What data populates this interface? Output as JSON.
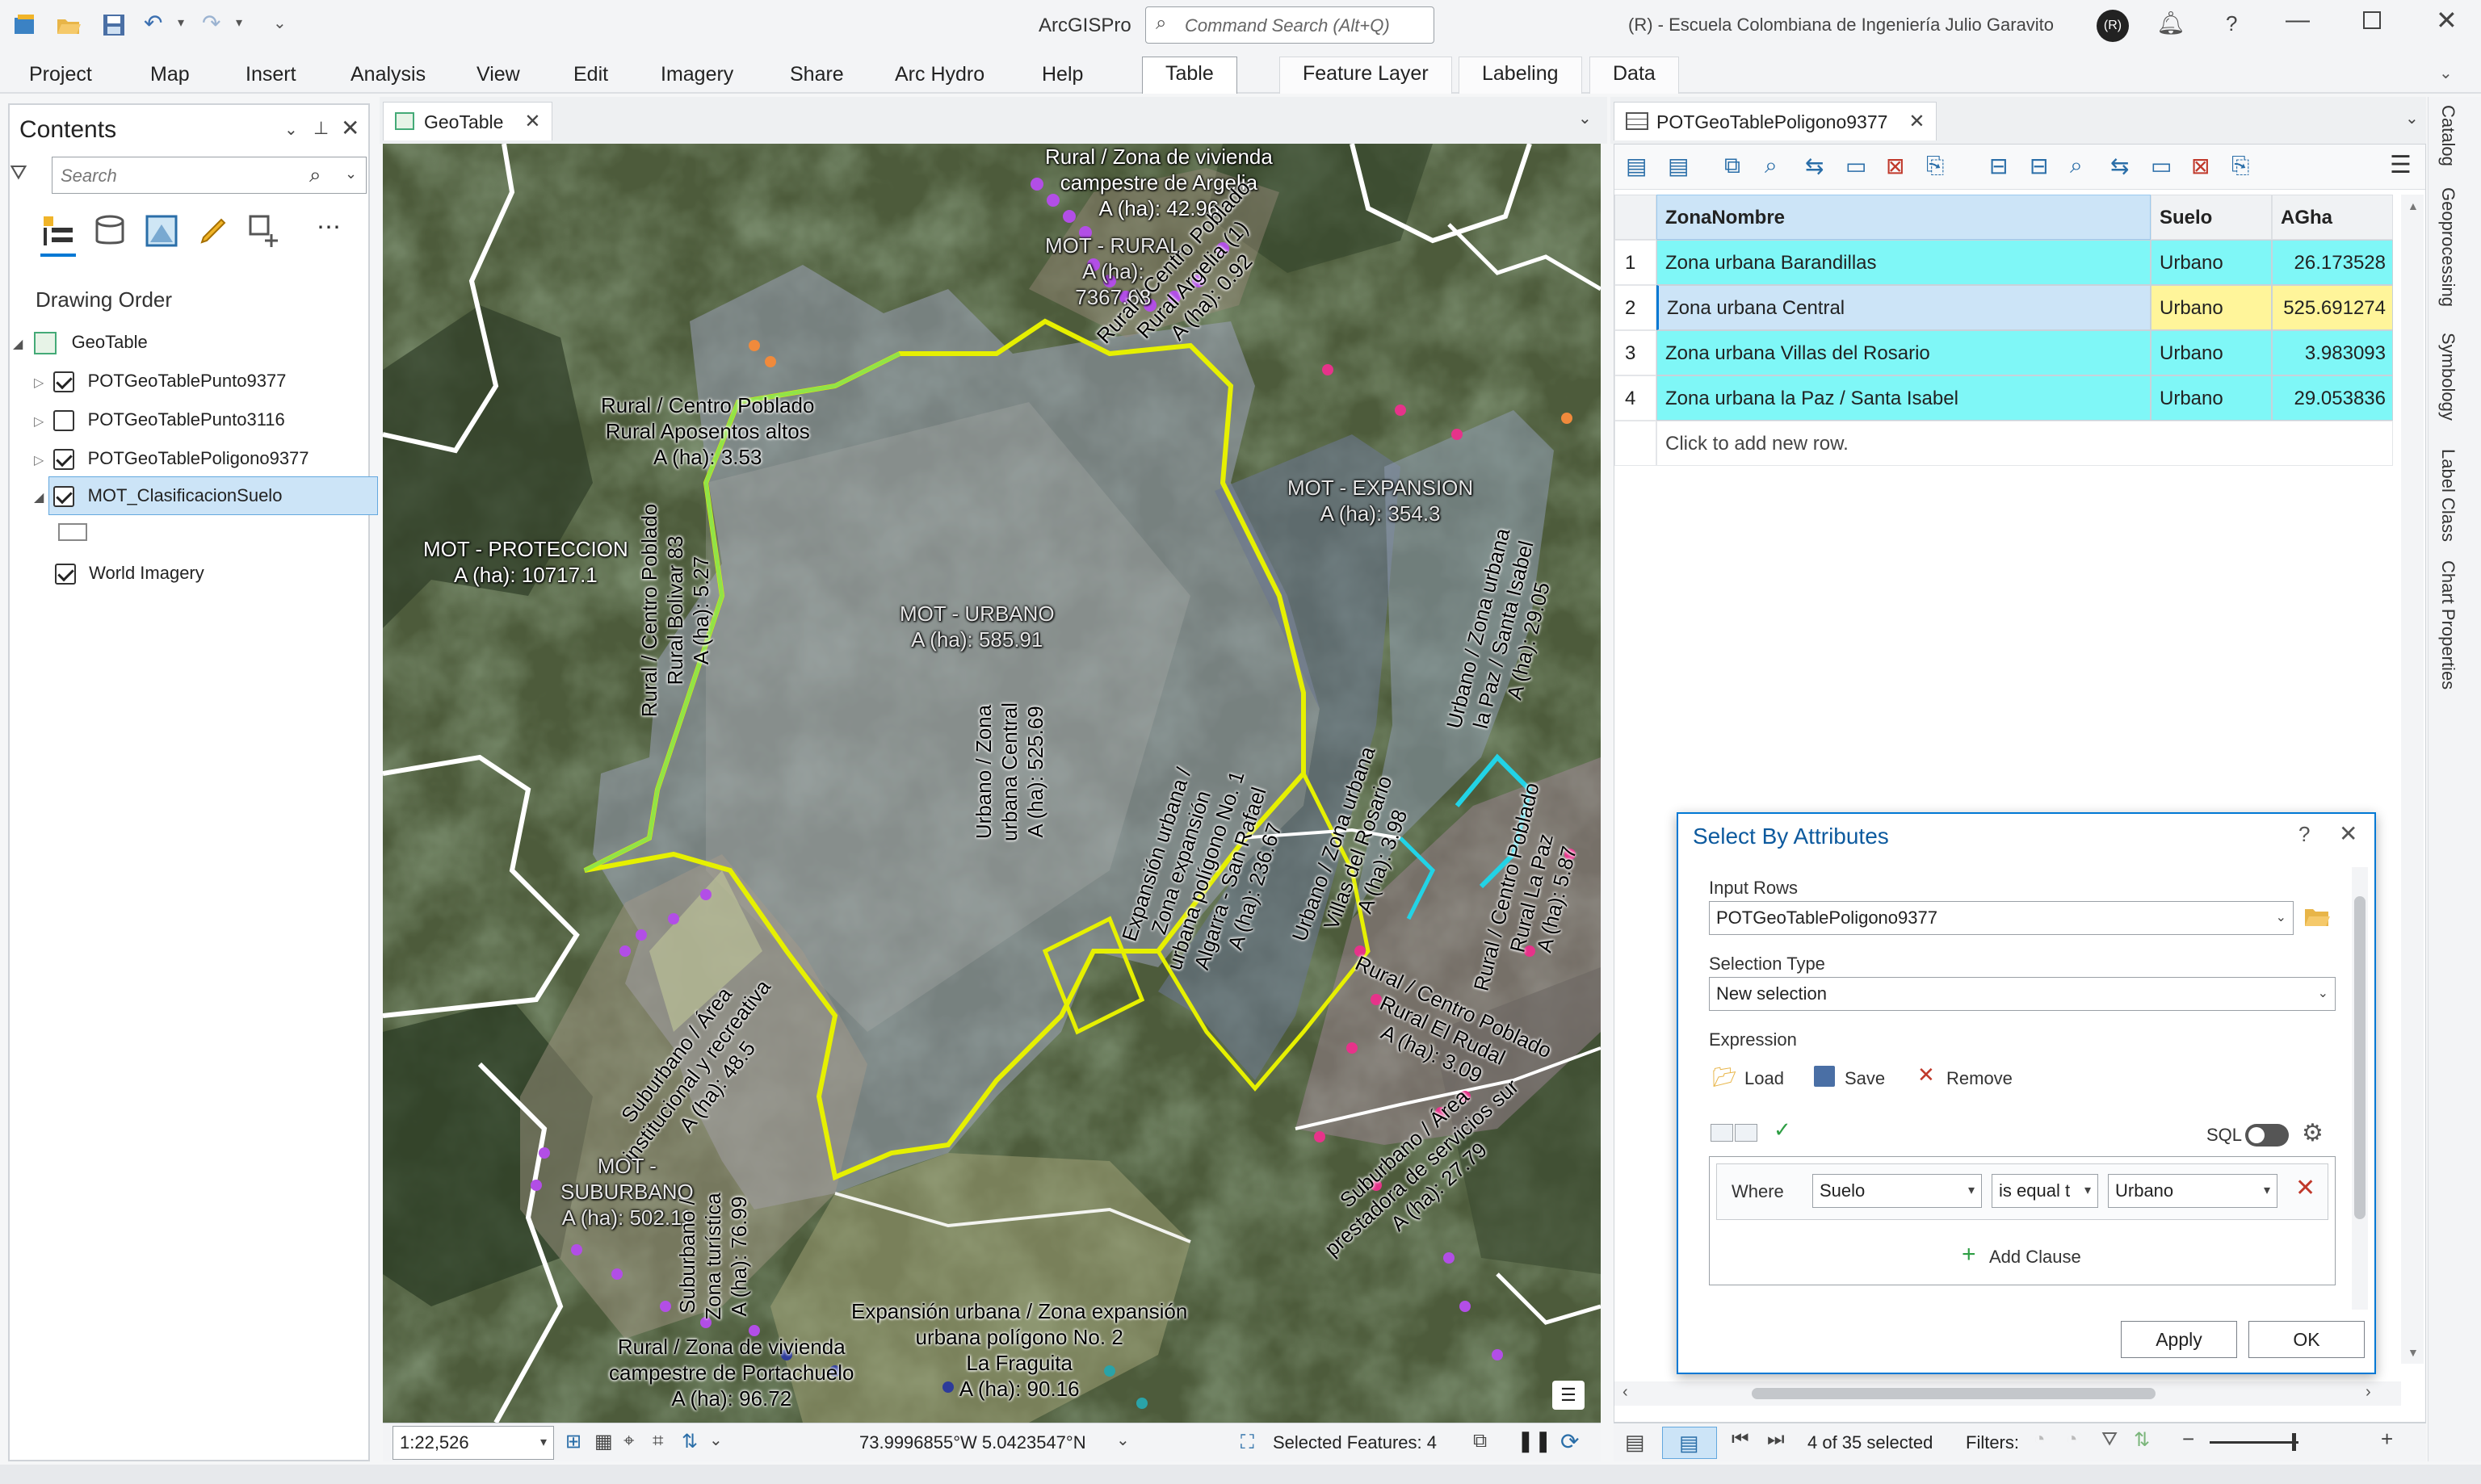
{
  "app": {
    "name": "ArcGISPro",
    "account": "(R) - Escuela Colombiana de Ingeniería Julio Garavito",
    "avatar": "(R)"
  },
  "command_search": {
    "placeholder": "Command Search (Alt+Q)"
  },
  "ribbon": {
    "tabs": [
      "Project",
      "Map",
      "Insert",
      "Analysis",
      "View",
      "Edit",
      "Imagery",
      "Share",
      "Arc Hydro",
      "Help"
    ],
    "context_tabs": [
      "Table",
      "Feature Layer",
      "Labeling",
      "Data"
    ]
  },
  "contents": {
    "title": "Contents",
    "search_placeholder": "Search",
    "heading": "Drawing Order",
    "map_name": "GeoTable",
    "layers": [
      {
        "name": "POTGeoTablePunto9377",
        "checked": true
      },
      {
        "name": "POTGeoTablePunto3116",
        "checked": false
      },
      {
        "name": "POTGeoTablePoligono9377",
        "checked": true
      },
      {
        "name": "MOT_ClasificacionSuelo",
        "checked": true,
        "selected": true
      },
      {
        "name": "World Imagery",
        "checked": true
      }
    ]
  },
  "map_view": {
    "tab": "GeoTable",
    "scale": "1:22,526",
    "coordinates": "73.9996855°W 5.0423547°N",
    "selected_features": "Selected Features: 4",
    "labels": {
      "argelia": "Rural / Zona de vivienda\ncampestre de Argelia\nA (ha): 42.96",
      "rural": "MOT - RURAL\nA (ha):\n7367.68",
      "cp_argelia": "Rural / Centro Poblado\nRural Argelia (1)\nA (ha): 0.92",
      "aposentos": "Rural / Centro Poblado\nRural Aposentos altos\nA (ha): 3.53",
      "proteccion": "MOT - PROTECCION\nA (ha): 10717.1",
      "bolivar": "Rural / Centro Poblado\nRural Bolivar 83\nA (ha): 5.27",
      "urbano": "MOT - URBANO\nA (ha): 585.91",
      "central": "Urbano / Zona\nurbana Central\nA (ha): 525.69",
      "expansion": "MOT - EXPANSION\nA (ha): 354.3",
      "algarra": "Expansión urbana /\nZona expansión\nurbana polígono No. 1\nAlgarra - San Rafael\nA (ha): 236.67",
      "villas": "Urbano / Zona urbana\nVillas del Rosario\nA (ha): 3.98",
      "lapaz": "Urbano / Zona urbana\nla Paz / Santa Isabel\nA (ha): 29.05",
      "laplaya": "Rural / Centro Poblado\nRural La Paz\nA (ha): 5.87",
      "rudal": "Rural / Centro Poblado\nRural El Rudal\nA (ha): 3.09",
      "servicios": "Suburbano / Área\nprestadora de servicios sur\nA (ha): 27.79",
      "institucional": "Suburbano / Área\ninstitucional y recreativa\nA (ha): 48.5",
      "suburbano": "MOT -\nSUBURBANO\nA (ha): 502.11",
      "turistica": "Suburbano /\nZona turística\nA (ha): 76.99",
      "fraguita": "Expansión urbana / Zona expansión\nurbana polígono No. 2\nLa Fraguita\nA (ha): 90.16",
      "portachuelo": "Rural / Zona de vivienda\ncampestre de Portachuelo\nA (ha): 96.72"
    }
  },
  "table_view": {
    "tab": "POTGeoTablePoligono9377",
    "columns": [
      "ZonaNombre",
      "Suelo",
      "AGha"
    ],
    "rows": [
      {
        "n": "1",
        "zona": "Zona urbana Barandillas",
        "suelo": "Urbano",
        "agha": "26.173528"
      },
      {
        "n": "2",
        "zona": "Zona urbana Central",
        "suelo": "Urbano",
        "agha": "525.691274"
      },
      {
        "n": "3",
        "zona": "Zona urbana Villas del Rosario",
        "suelo": "Urbano",
        "agha": "3.983093"
      },
      {
        "n": "4",
        "zona": "Zona urbana la Paz / Santa Isabel",
        "suelo": "Urbano",
        "agha": "29.053836"
      }
    ],
    "add_row": "Click to add new row.",
    "status": "4 of 35 selected",
    "filters_label": "Filters:"
  },
  "side_tabs": [
    "Catalog",
    "Geoprocessing",
    "Symbology",
    "Label Class",
    "Chart Properties"
  ],
  "select_by_attributes": {
    "title": "Select By Attributes",
    "input_rows_label": "Input Rows",
    "input_rows_value": "POTGeoTablePoligono9377",
    "selection_type_label": "Selection Type",
    "selection_type_value": "New selection",
    "expression_label": "Expression",
    "load": "Load",
    "save": "Save",
    "remove": "Remove",
    "sql": "SQL",
    "where": "Where",
    "field": "Suelo",
    "operator": "is equal t",
    "value": "Urbano",
    "add_clause": "Add Clause",
    "apply": "Apply",
    "ok": "OK"
  },
  "colors": {
    "accent": "#0078d4",
    "selection_cyan": "#7ff7f7",
    "highlight_yellow": "#fff59a",
    "urban_outline": "#e6f000",
    "purple": "#b24ee6"
  }
}
